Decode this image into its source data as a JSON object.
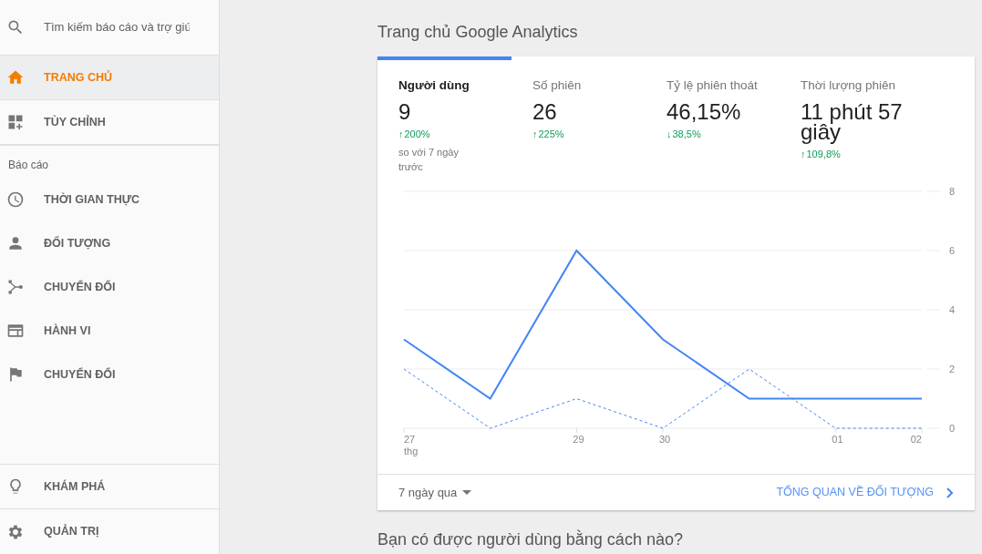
{
  "sidebar": {
    "search": {
      "placeholder": "Tìm kiếm báo cáo và trợ giú"
    },
    "top_items": [
      {
        "label": "TRANG CHỦ",
        "kind": "home",
        "selected": true
      },
      {
        "label": "TÙY CHỈNH",
        "kind": "customize",
        "selected": false
      }
    ],
    "section_label": "Báo cáo",
    "report_items": [
      {
        "label": "THỜI GIAN THỰC",
        "kind": "clock",
        "selected": false
      },
      {
        "label": "ĐỐI TƯỢNG",
        "kind": "person",
        "selected": false
      },
      {
        "label": "CHUYỂN ĐỔI",
        "kind": "fork",
        "selected": false
      },
      {
        "label": "HÀNH VI",
        "kind": "window",
        "selected": false
      },
      {
        "label": "CHUYỂN ĐỔI",
        "kind": "flag",
        "selected": false
      }
    ],
    "bottom_items": [
      {
        "label": "KHÁM PHÁ",
        "kind": "bulb",
        "selected": false
      },
      {
        "label": "QUẢN TRỊ",
        "kind": "gear",
        "selected": false
      }
    ]
  },
  "main": {
    "title": "Trang chủ Google Analytics",
    "metrics": [
      {
        "label": "Người dùng",
        "value": "9",
        "change": "200%",
        "arrow": "↑",
        "note": "so với 7 ngày trước",
        "selected": true
      },
      {
        "label": "Số phiên",
        "value": "26",
        "change": "225%",
        "arrow": "↑",
        "selected": false
      },
      {
        "label": "Tỷ lệ phiên thoát",
        "value": "46,15%",
        "change": "38,5%",
        "arrow": "↓",
        "selected": false
      },
      {
        "label": "Thời lượng phiên",
        "value": "11 phút 57 giây",
        "change": "109,8%",
        "arrow": "↑",
        "selected": false
      }
    ],
    "chart_data": {
      "type": "line",
      "categories": [
        "27 thg",
        null,
        "29",
        "30",
        null,
        "01",
        "02"
      ],
      "series": [
        {
          "color": "#4285f4",
          "line_style": "solid",
          "values": [
            3,
            1,
            6,
            3,
            1,
            1,
            1
          ]
        },
        {
          "color": "#4285f4",
          "line_style": "dashed",
          "values": [
            2,
            0,
            1,
            0,
            2,
            0,
            0
          ]
        }
      ],
      "grid": true,
      "ylim": [
        0,
        8
      ],
      "yticks": [
        0,
        2,
        4,
        6,
        8
      ]
    },
    "date_range": "7 ngày qua",
    "link": "TỔNG QUAN VỀ ĐỐI TƯỢNG",
    "next_title": "Bạn có được người dùng bằng cách nào?"
  }
}
